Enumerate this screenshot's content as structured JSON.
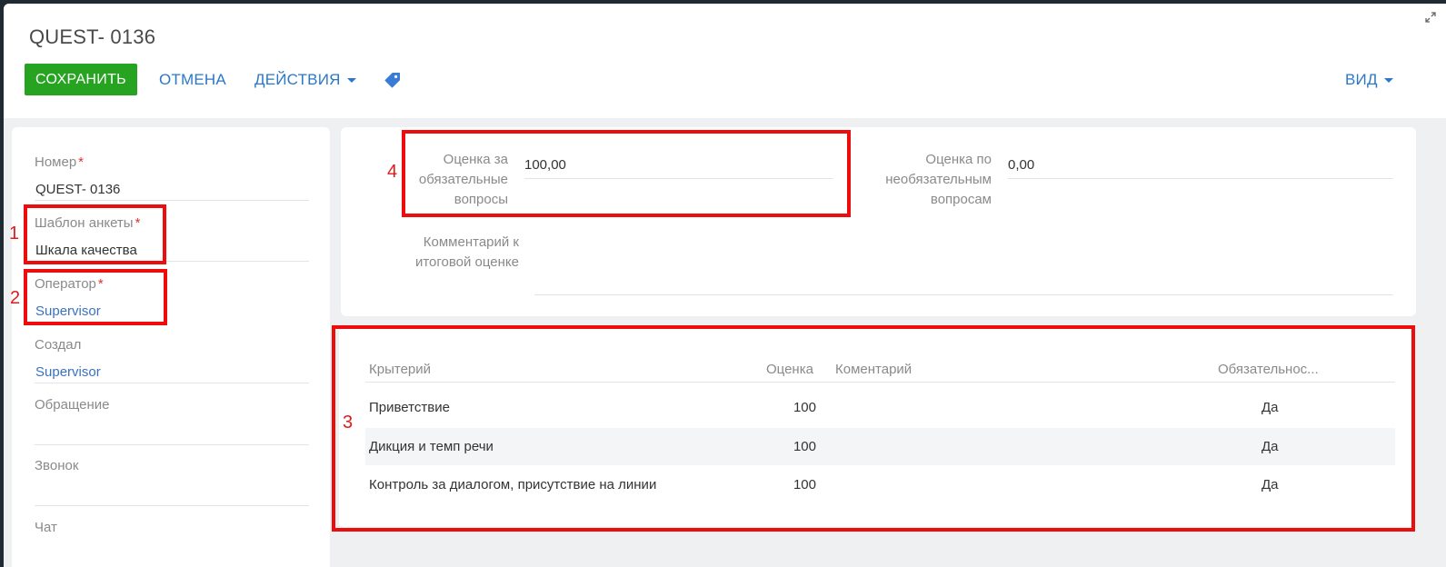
{
  "header": {
    "title": "QUEST- 0136",
    "save_label": "СОХРАНИТЬ",
    "cancel_label": "ОТМЕНА",
    "actions_label": "ДЕЙСТВИЯ",
    "view_label": "ВИД"
  },
  "left_fields": [
    {
      "label": "Номер",
      "required": "*",
      "value": "QUEST- 0136"
    },
    {
      "label": "Шаблон анкеты",
      "required": "*",
      "value": "Шкала качества"
    },
    {
      "label": "Оператор",
      "required": "*",
      "value": "Supervisor"
    },
    {
      "label": "Создал",
      "value": "Supervisor"
    },
    {
      "label": "Обращение",
      "value": ""
    },
    {
      "label": "Звонок",
      "value": ""
    },
    {
      "label": "Чат",
      "value": ""
    }
  ],
  "scores": {
    "mandatory_label_1": "Оценка за",
    "mandatory_label_2": "обязательные",
    "mandatory_label_3": "вопросы",
    "mandatory_value": "100,00",
    "optional_label_1": "Оценка по",
    "optional_label_2": "необязательным",
    "optional_label_3": "вопросам",
    "optional_value": "0,00",
    "comment_label_1": "Комментарий к",
    "comment_label_2": "итоговой оценке",
    "comment_value": ""
  },
  "table": {
    "columns": [
      "Крытерий",
      "Оценка",
      "Коментарий",
      "Обязательнос..."
    ],
    "rows": [
      {
        "criterion": "Приветствие",
        "score": "100",
        "comment": "",
        "required": "Да"
      },
      {
        "criterion": "Дикция и темп речи",
        "score": "100",
        "comment": "",
        "required": "Да"
      },
      {
        "criterion": "Контроль за диалогом, присутствие на линии",
        "score": "100",
        "comment": "",
        "required": "Да"
      }
    ]
  },
  "annotations": [
    "1",
    "2",
    "3",
    "4"
  ],
  "colors": {
    "save_button": "#26a421",
    "link": "#2a79c7",
    "required_mark": "#e0342f",
    "annotation": "#ee0d0d"
  },
  "icons": [
    "expand-icon",
    "caret-down-icon",
    "tag-icon"
  ]
}
